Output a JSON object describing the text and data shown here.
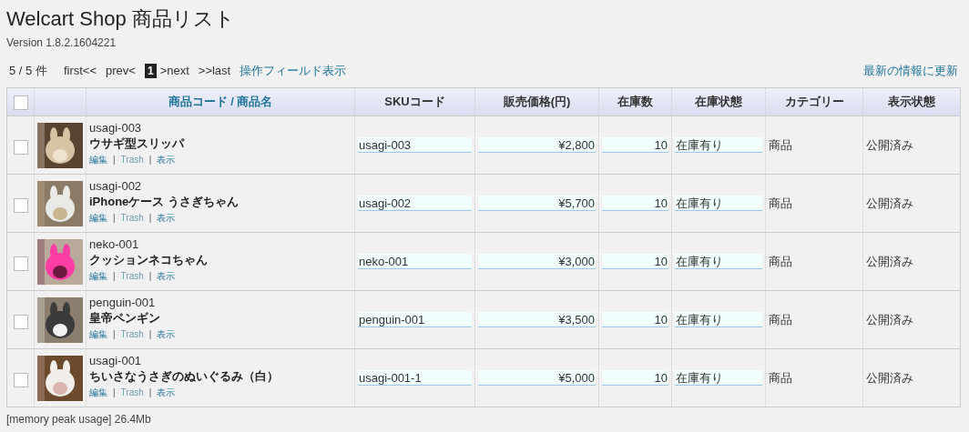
{
  "page": {
    "title": "Welcart Shop 商品リスト",
    "version": "Version 1.8.2.1604221"
  },
  "toolbar": {
    "count": "5 / 5 件",
    "pagination": [
      {
        "label": "first<<",
        "selected": false
      },
      {
        "label": "prev<",
        "selected": false
      },
      {
        "label": "1",
        "selected": true
      },
      {
        "label": ">next",
        "selected": false
      },
      {
        "label": ">>last",
        "selected": false
      }
    ],
    "field_toggle": "操作フィールド表示",
    "refresh": "最新の情報に更新"
  },
  "table": {
    "select_all": {
      "checked": false
    },
    "columns": [
      {
        "label": "商品コード / 商品名",
        "kind": "link"
      },
      {
        "label": "SKUコード",
        "kind": "plain"
      },
      {
        "label": "販売価格(円)",
        "kind": "plain"
      },
      {
        "label": "在庫数",
        "kind": "plain"
      },
      {
        "label": "在庫状態",
        "kind": "plain"
      },
      {
        "label": "カテゴリー",
        "kind": "plain"
      },
      {
        "label": "表示状態",
        "kind": "plain"
      }
    ],
    "rows": [
      {
        "checked": false,
        "code": "usagi-003",
        "name": "ウサギ型スリッパ",
        "actions": [
          {
            "kind": "link",
            "text": "編集"
          },
          {
            "kind": "separator",
            "text": "|"
          },
          {
            "kind": "trash",
            "text": "Trash"
          },
          {
            "kind": "separator",
            "text": "|"
          },
          {
            "kind": "link",
            "text": "表示"
          }
        ],
        "sku": "usagi-003",
        "price": "¥2,800",
        "stock": "10",
        "stock_status": "在庫有り",
        "category": "商品",
        "visibility": "公開済み"
      },
      {
        "checked": false,
        "code": "usagi-002",
        "name": "iPhoneケース うさぎちゃん",
        "actions": [
          {
            "kind": "link",
            "text": "編集"
          },
          {
            "kind": "separator",
            "text": "|"
          },
          {
            "kind": "trash",
            "text": "Trash"
          },
          {
            "kind": "separator",
            "text": "|"
          },
          {
            "kind": "link",
            "text": "表示"
          }
        ],
        "sku": "usagi-002",
        "price": "¥5,700",
        "stock": "10",
        "stock_status": "在庫有り",
        "category": "商品",
        "visibility": "公開済み"
      },
      {
        "checked": false,
        "code": "neko-001",
        "name": "クッションネコちゃん",
        "actions": [
          {
            "kind": "link",
            "text": "編集"
          },
          {
            "kind": "separator",
            "text": "|"
          },
          {
            "kind": "trash",
            "text": "Trash"
          },
          {
            "kind": "separator",
            "text": "|"
          },
          {
            "kind": "link",
            "text": "表示"
          }
        ],
        "sku": "neko-001",
        "price": "¥3,000",
        "stock": "10",
        "stock_status": "在庫有り",
        "category": "商品",
        "visibility": "公開済み"
      },
      {
        "checked": false,
        "code": "penguin-001",
        "name": "皇帝ペンギン",
        "actions": [
          {
            "kind": "link",
            "text": "編集"
          },
          {
            "kind": "separator",
            "text": "|"
          },
          {
            "kind": "trash",
            "text": "Trash"
          },
          {
            "kind": "separator",
            "text": "|"
          },
          {
            "kind": "link",
            "text": "表示"
          }
        ],
        "sku": "penguin-001",
        "price": "¥3,500",
        "stock": "10",
        "stock_status": "在庫有り",
        "category": "商品",
        "visibility": "公開済み"
      },
      {
        "checked": false,
        "code": "usagi-001",
        "name": "ちいさなうさぎのぬいぐるみ（白）",
        "actions": [
          {
            "kind": "link",
            "text": "編集"
          },
          {
            "kind": "separator",
            "text": "|"
          },
          {
            "kind": "trash",
            "text": "Trash"
          },
          {
            "kind": "separator",
            "text": "|"
          },
          {
            "kind": "link",
            "text": "表示"
          }
        ],
        "sku": "usagi-001-1",
        "price": "¥5,000",
        "stock": "10",
        "stock_status": "在庫有り",
        "category": "商品",
        "visibility": "公開済み"
      }
    ]
  },
  "footer": "[memory peak usage] 26.4Mb"
}
